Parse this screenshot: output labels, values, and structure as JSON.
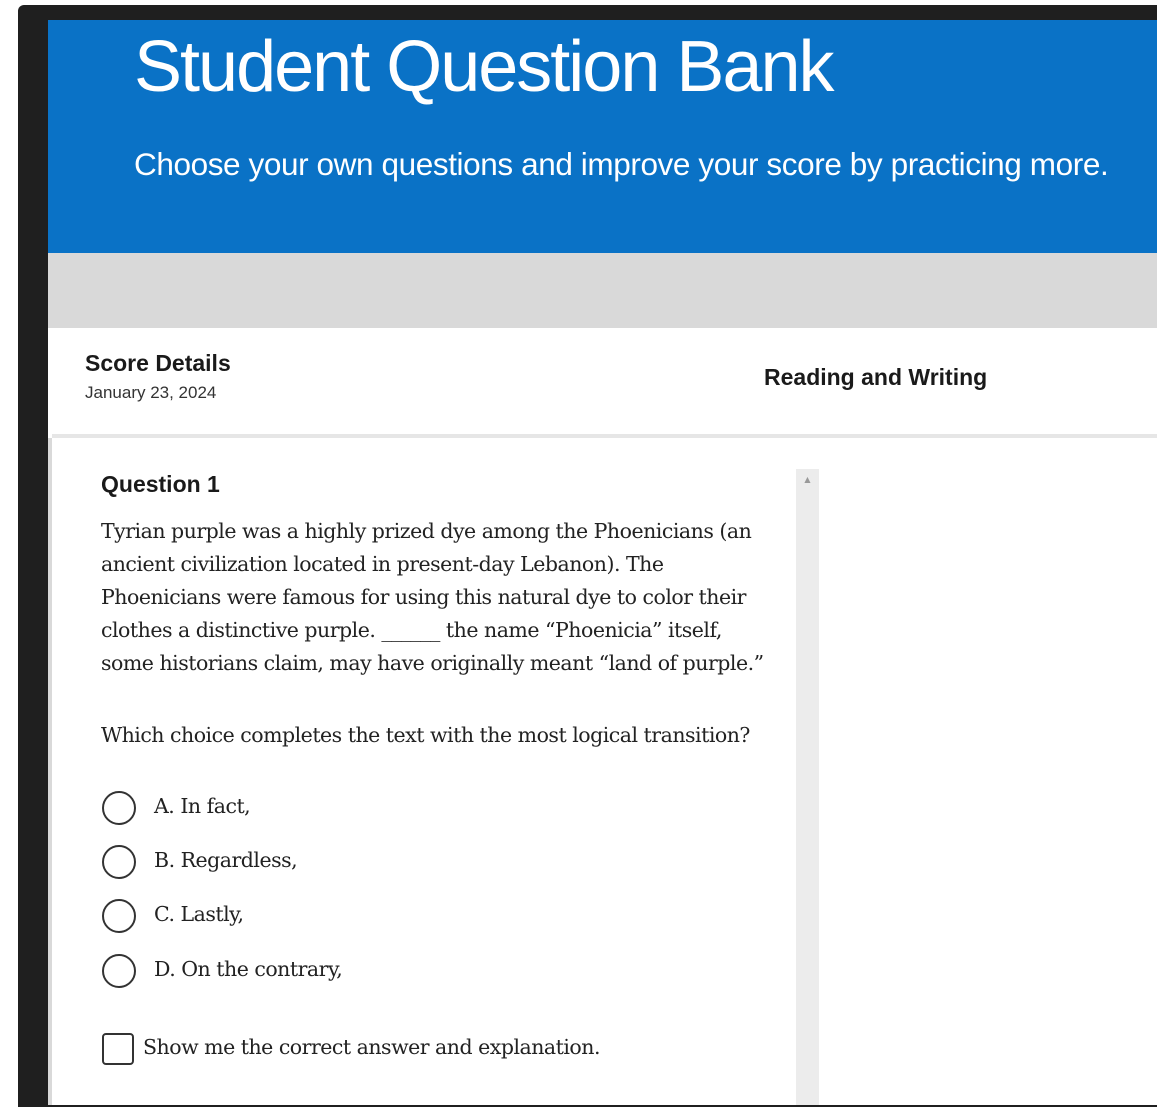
{
  "header": {
    "title": "Student Question Bank",
    "subtitle": "Choose your own questions and improve your score by practicing more."
  },
  "score_details": {
    "title": "Score Details",
    "date": "January 23, 2024",
    "section": "Reading and Writing"
  },
  "question": {
    "heading": "Question 1",
    "passage_lines": [
      "Tyrian purple was a highly prized dye among the Phoenicians (an",
      "ancient civilization located in present-day Lebanon). The",
      "Phoenicians were famous for using this natural dye to color their",
      "clothes a distinctive purple. ______ the name “Phoenicia” itself,",
      "some historians claim, may have originally meant “land of purple.”"
    ],
    "prompt": "Which choice completes the text with the most logical transition?",
    "options": [
      {
        "label": "A. In fact,"
      },
      {
        "label": "B. Regardless,"
      },
      {
        "label": "C. Lastly,"
      },
      {
        "label": "D. On the contrary,"
      }
    ],
    "show_answer_label": "Show me the correct answer and explanation."
  },
  "scrollbar": {
    "up_icon": "triangle-up-icon"
  },
  "colors": {
    "header_blue": "#0a72c6",
    "gray_band": "#d9d9d9",
    "frame": "#1f1f1f"
  }
}
